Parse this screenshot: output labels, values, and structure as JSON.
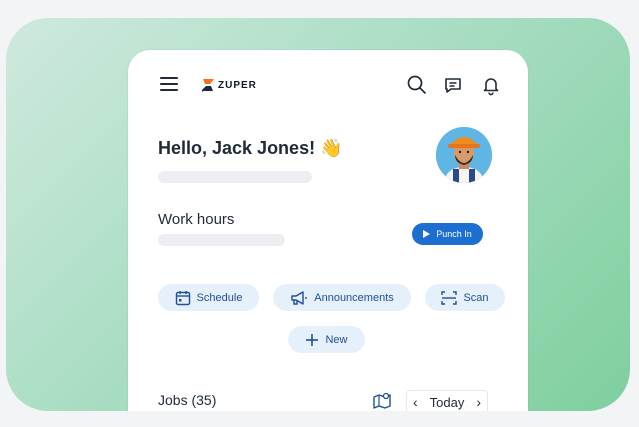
{
  "brand": {
    "logo_text": "ZUPER",
    "logo_colors": [
      "#f97316",
      "#1f2937"
    ]
  },
  "header": {
    "icons": [
      "menu-icon",
      "search-icon",
      "messages-icon",
      "notifications-icon"
    ]
  },
  "greeting": {
    "text": "Hello, Jack Jones! 👋"
  },
  "work_hours": {
    "label": "Work hours",
    "punch_label": "Punch In"
  },
  "quick_actions": [
    {
      "label": "Schedule",
      "icon": "calendar-icon"
    },
    {
      "label": "Announcements",
      "icon": "megaphone-icon"
    },
    {
      "label": "Scan",
      "icon": "scan-icon"
    },
    {
      "label": "New",
      "icon": "plus-icon"
    }
  ],
  "jobs": {
    "label": "Jobs (35)",
    "date_label": "Today"
  },
  "colors": {
    "accent": "#1c6fd1",
    "chip_bg": "#e6f0fb",
    "chip_text": "#1e4f9a",
    "background_gradient": [
      "#cfe9de",
      "#7fcf9f"
    ]
  }
}
